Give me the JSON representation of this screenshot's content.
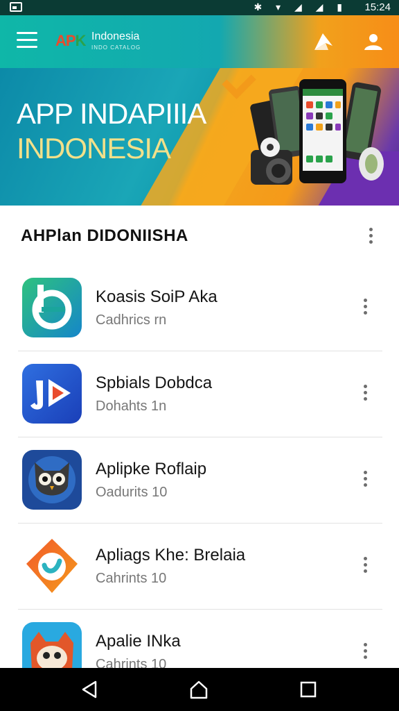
{
  "status_bar": {
    "time": "15:24",
    "icons": [
      "bluetooth-icon",
      "wifi-icon",
      "signal-icon",
      "battery-icon"
    ]
  },
  "app_bar": {
    "logo_mark": "APK",
    "logo_name": "Indonesia",
    "logo_sub": "INDO CATALOG",
    "icons": [
      "menu-icon",
      "share-icon",
      "user-icon"
    ]
  },
  "banner": {
    "line1": "APP INDAPIIIA",
    "line2": "INDONESIA"
  },
  "section": {
    "title": "AHPlan DIDONIISHA"
  },
  "apps": [
    {
      "name": "Koasis SoiP Aka",
      "sub": "Cadhrics rn",
      "icon": "b-circle-icon"
    },
    {
      "name": "Spbials Dobdca",
      "sub": "Dohahts 1n",
      "icon": "play-arrow-icon"
    },
    {
      "name": "Aplipke Roflaip",
      "sub": "Oadurits 10",
      "icon": "owl-icon"
    },
    {
      "name": "Apliags Khe: Brelaia",
      "sub": "Cahrints 10",
      "icon": "check-shield-icon"
    },
    {
      "name": "Apalie INka",
      "sub": "Cahrints 10",
      "icon": "cat-mascot-icon"
    }
  ],
  "colors": {
    "app_bar_teal": "#13a8b0",
    "app_bar_orange": "#f78d17",
    "status_bar": "#0b3b34",
    "nav_bar": "#000000"
  }
}
